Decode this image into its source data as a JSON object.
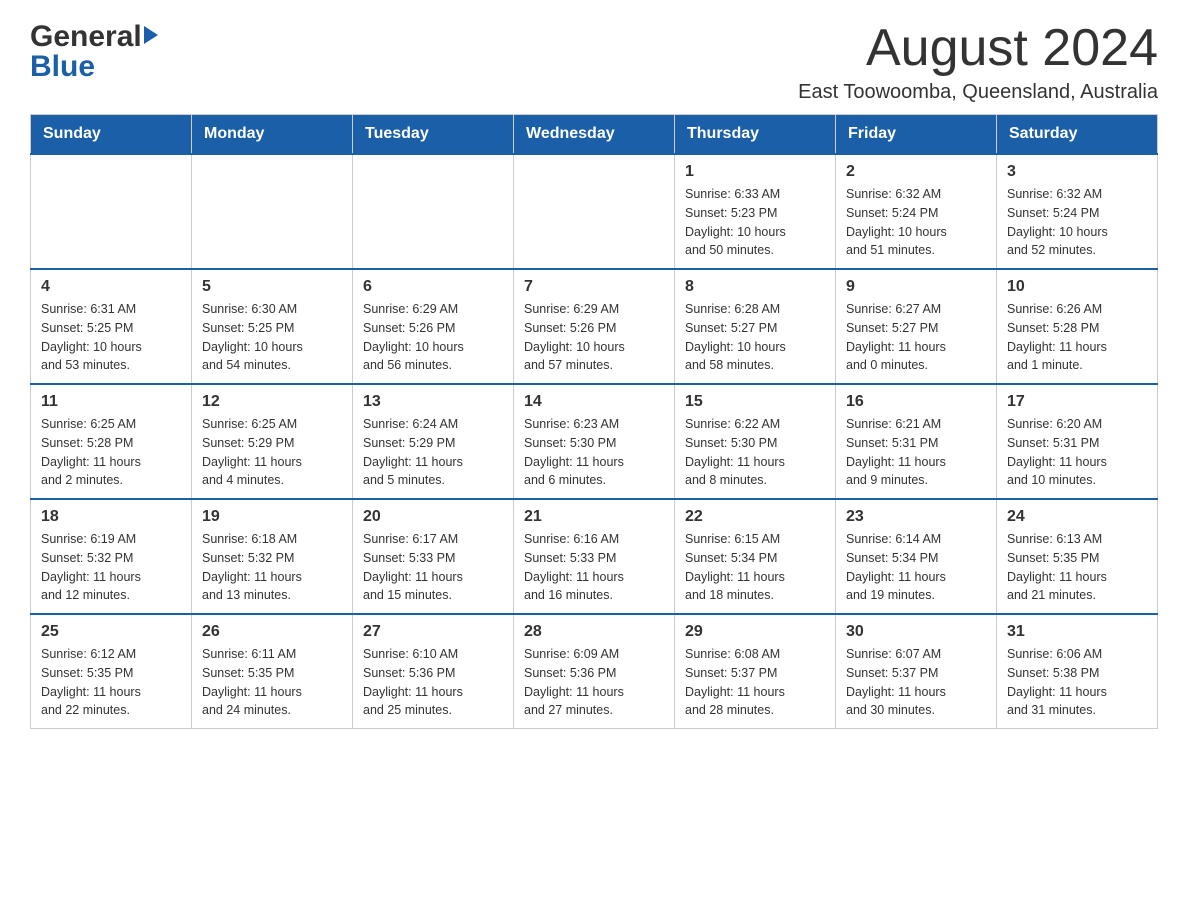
{
  "header": {
    "logo_general": "General",
    "logo_blue": "Blue",
    "month_title": "August 2024",
    "location": "East Toowoomba, Queensland, Australia"
  },
  "calendar": {
    "days_of_week": [
      "Sunday",
      "Monday",
      "Tuesday",
      "Wednesday",
      "Thursday",
      "Friday",
      "Saturday"
    ],
    "weeks": [
      [
        {
          "day": "",
          "info": ""
        },
        {
          "day": "",
          "info": ""
        },
        {
          "day": "",
          "info": ""
        },
        {
          "day": "",
          "info": ""
        },
        {
          "day": "1",
          "info": "Sunrise: 6:33 AM\nSunset: 5:23 PM\nDaylight: 10 hours\nand 50 minutes."
        },
        {
          "day": "2",
          "info": "Sunrise: 6:32 AM\nSunset: 5:24 PM\nDaylight: 10 hours\nand 51 minutes."
        },
        {
          "day": "3",
          "info": "Sunrise: 6:32 AM\nSunset: 5:24 PM\nDaylight: 10 hours\nand 52 minutes."
        }
      ],
      [
        {
          "day": "4",
          "info": "Sunrise: 6:31 AM\nSunset: 5:25 PM\nDaylight: 10 hours\nand 53 minutes."
        },
        {
          "day": "5",
          "info": "Sunrise: 6:30 AM\nSunset: 5:25 PM\nDaylight: 10 hours\nand 54 minutes."
        },
        {
          "day": "6",
          "info": "Sunrise: 6:29 AM\nSunset: 5:26 PM\nDaylight: 10 hours\nand 56 minutes."
        },
        {
          "day": "7",
          "info": "Sunrise: 6:29 AM\nSunset: 5:26 PM\nDaylight: 10 hours\nand 57 minutes."
        },
        {
          "day": "8",
          "info": "Sunrise: 6:28 AM\nSunset: 5:27 PM\nDaylight: 10 hours\nand 58 minutes."
        },
        {
          "day": "9",
          "info": "Sunrise: 6:27 AM\nSunset: 5:27 PM\nDaylight: 11 hours\nand 0 minutes."
        },
        {
          "day": "10",
          "info": "Sunrise: 6:26 AM\nSunset: 5:28 PM\nDaylight: 11 hours\nand 1 minute."
        }
      ],
      [
        {
          "day": "11",
          "info": "Sunrise: 6:25 AM\nSunset: 5:28 PM\nDaylight: 11 hours\nand 2 minutes."
        },
        {
          "day": "12",
          "info": "Sunrise: 6:25 AM\nSunset: 5:29 PM\nDaylight: 11 hours\nand 4 minutes."
        },
        {
          "day": "13",
          "info": "Sunrise: 6:24 AM\nSunset: 5:29 PM\nDaylight: 11 hours\nand 5 minutes."
        },
        {
          "day": "14",
          "info": "Sunrise: 6:23 AM\nSunset: 5:30 PM\nDaylight: 11 hours\nand 6 minutes."
        },
        {
          "day": "15",
          "info": "Sunrise: 6:22 AM\nSunset: 5:30 PM\nDaylight: 11 hours\nand 8 minutes."
        },
        {
          "day": "16",
          "info": "Sunrise: 6:21 AM\nSunset: 5:31 PM\nDaylight: 11 hours\nand 9 minutes."
        },
        {
          "day": "17",
          "info": "Sunrise: 6:20 AM\nSunset: 5:31 PM\nDaylight: 11 hours\nand 10 minutes."
        }
      ],
      [
        {
          "day": "18",
          "info": "Sunrise: 6:19 AM\nSunset: 5:32 PM\nDaylight: 11 hours\nand 12 minutes."
        },
        {
          "day": "19",
          "info": "Sunrise: 6:18 AM\nSunset: 5:32 PM\nDaylight: 11 hours\nand 13 minutes."
        },
        {
          "day": "20",
          "info": "Sunrise: 6:17 AM\nSunset: 5:33 PM\nDaylight: 11 hours\nand 15 minutes."
        },
        {
          "day": "21",
          "info": "Sunrise: 6:16 AM\nSunset: 5:33 PM\nDaylight: 11 hours\nand 16 minutes."
        },
        {
          "day": "22",
          "info": "Sunrise: 6:15 AM\nSunset: 5:34 PM\nDaylight: 11 hours\nand 18 minutes."
        },
        {
          "day": "23",
          "info": "Sunrise: 6:14 AM\nSunset: 5:34 PM\nDaylight: 11 hours\nand 19 minutes."
        },
        {
          "day": "24",
          "info": "Sunrise: 6:13 AM\nSunset: 5:35 PM\nDaylight: 11 hours\nand 21 minutes."
        }
      ],
      [
        {
          "day": "25",
          "info": "Sunrise: 6:12 AM\nSunset: 5:35 PM\nDaylight: 11 hours\nand 22 minutes."
        },
        {
          "day": "26",
          "info": "Sunrise: 6:11 AM\nSunset: 5:35 PM\nDaylight: 11 hours\nand 24 minutes."
        },
        {
          "day": "27",
          "info": "Sunrise: 6:10 AM\nSunset: 5:36 PM\nDaylight: 11 hours\nand 25 minutes."
        },
        {
          "day": "28",
          "info": "Sunrise: 6:09 AM\nSunset: 5:36 PM\nDaylight: 11 hours\nand 27 minutes."
        },
        {
          "day": "29",
          "info": "Sunrise: 6:08 AM\nSunset: 5:37 PM\nDaylight: 11 hours\nand 28 minutes."
        },
        {
          "day": "30",
          "info": "Sunrise: 6:07 AM\nSunset: 5:37 PM\nDaylight: 11 hours\nand 30 minutes."
        },
        {
          "day": "31",
          "info": "Sunrise: 6:06 AM\nSunset: 5:38 PM\nDaylight: 11 hours\nand 31 minutes."
        }
      ]
    ]
  }
}
